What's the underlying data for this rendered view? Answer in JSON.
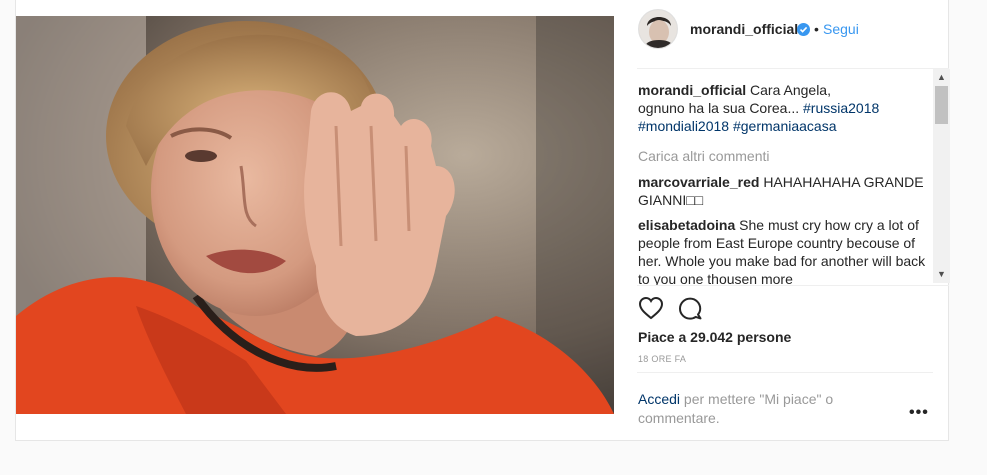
{
  "post": {
    "image_alt": "post photo"
  },
  "header": {
    "username": "morandi_official",
    "separator": "•",
    "follow_label": "Segui"
  },
  "caption": {
    "username": "morandi_official",
    "text": "Cara Angela,",
    "text_line2": "ognuno ha la sua Corea...",
    "hashtags": [
      "#russia2018",
      "#mondiali2018",
      "#germaniaacasa"
    ]
  },
  "load_more_label": "Carica altri commenti",
  "comments": [
    {
      "username": "marcovarriale_red",
      "text": "HAHAHAHAHA GRANDE GIANNI□□"
    },
    {
      "username": "elisabetadoina",
      "text": "She must cry how cry a lot of people from East Europe country becouse of her. Whole you make bad for another will back to you one thousen more"
    }
  ],
  "actions": {
    "like_icon": "heart-icon",
    "comment_icon": "comment-bubble-icon"
  },
  "likes_text": "Piace a 29.042 persone",
  "timestamp": "18 ORE FA",
  "login_prompt": {
    "link": "Accedi",
    "text": " per mettere \"Mi piace\" o commentare."
  },
  "more_label": "•••",
  "colors": {
    "link_blue": "#3897f0",
    "hashtag": "#003569",
    "muted": "#999999",
    "verified": "#3897f0"
  }
}
